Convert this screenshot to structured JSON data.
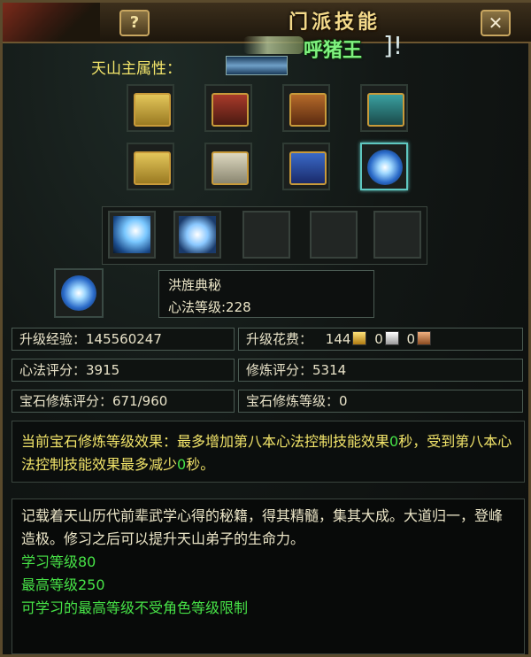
{
  "window": {
    "title": "门派技能",
    "help_label": "?",
    "close_label": "✕",
    "overlay_name": "呼猪王",
    "overlay_bracket": "]!"
  },
  "attribute": {
    "label": "天山主属性："
  },
  "skill_books": [
    {
      "icon": "scroll-book-icon",
      "color": "yellow"
    },
    {
      "icon": "red-book-icon",
      "color": "red"
    },
    {
      "icon": "brown-book-icon",
      "color": "brown"
    },
    {
      "icon": "teal-book-icon",
      "color": "teal"
    },
    {
      "icon": "open-book-icon",
      "color": "yellow"
    },
    {
      "icon": "white-book-icon",
      "color": "white"
    },
    {
      "icon": "blue-book-icon",
      "color": "blue"
    },
    {
      "icon": "galaxy-orb-icon",
      "color": "orb",
      "selected": true
    }
  ],
  "skill_slots": [
    "lightning-strike-icon",
    "whirlwind-icon",
    "empty",
    "empty",
    "empty"
  ],
  "selected": {
    "name": "洪旌典秘",
    "level_line": "心法等级:228"
  },
  "stats": {
    "upgrade_exp": "升级经验：145560247",
    "upgrade_cost_label": "升级花费：",
    "cost_gold": "144",
    "cost_silver": "0",
    "cost_copper": "0",
    "xinfa_score": "心法评分：3915",
    "xiulian_score": "修炼评分：5314",
    "gem_score": "宝石修炼评分：671/960",
    "gem_level": "宝石修炼等级：0"
  },
  "effect": {
    "part1": "当前宝石修炼等级效果：最多增加第八本心法控制技能效果",
    "value1": "0",
    "part2": "秒，受到第八本心法控制技能效果最多减少",
    "value2": "0",
    "part3": "秒。"
  },
  "description": {
    "text": "记载着天山历代前辈武学心得的秘籍，得其精髓，集其大成。大道归一，登峰造极。修习之后可以提升天山弟子的生命力。",
    "learn_level": "学习等级80",
    "max_level": "最高等级250",
    "note": "可学习的最高等级不受角色等级限制"
  },
  "colors": {
    "accent_yellow": "#f3e56a",
    "green_value": "#47e347",
    "panel_border": "#4a5a52"
  }
}
